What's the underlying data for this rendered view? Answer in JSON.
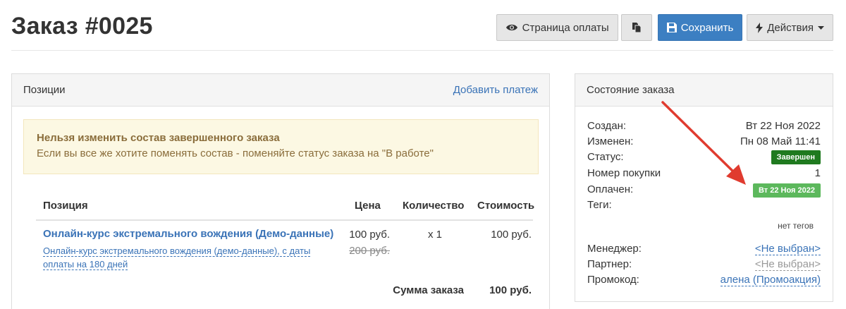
{
  "page": {
    "title": "Заказ #0025"
  },
  "toolbar": {
    "payment_page_label": "Страница оплаты",
    "copy_icon": "copy-icon",
    "save_label": "Сохранить",
    "actions_label": "Действия"
  },
  "positions": {
    "title": "Позиции",
    "add_payment_label": "Добавить платеж",
    "alert": {
      "title": "Нельзя изменить состав завершенного заказа",
      "text": "Если вы все же хотите поменять состав - поменяйте статус заказа на \"В работе\""
    },
    "columns": {
      "item": "Позиция",
      "price": "Цена",
      "qty": "Количество",
      "cost": "Стоимость"
    },
    "items": [
      {
        "title": "Онлайн-курс экстремального вождения (Демо-данные)",
        "description": "Онлайн-курс экстремального вождения (демо-данные), с даты оплаты на 180 дней",
        "price": "100 руб.",
        "price_old": "200 руб.",
        "qty": "x 1",
        "cost": "100 руб."
      }
    ],
    "total_label": "Сумма заказа",
    "total_value": "100 руб."
  },
  "state": {
    "title": "Состояние заказа",
    "created_label": "Создан:",
    "created_value": "Вт 22 Ноя 2022",
    "modified_label": "Изменен:",
    "modified_value": "Пн 08 Май 11:41",
    "status_label": "Статус:",
    "status_value": "Завершен",
    "purchase_label": "Номер покупки",
    "purchase_value": "1",
    "paid_label": "Оплачен:",
    "paid_value": "Вт 22 Ноя 2022",
    "tags_label": "Теги:",
    "no_tags": "нет тегов",
    "manager_label": "Менеджер:",
    "manager_value": "<Не выбран>",
    "partner_label": "Партнер:",
    "partner_value": "<Не выбран>",
    "promo_label": "Промокод:",
    "promo_value": "алена (Промоакция)"
  },
  "colors": {
    "primary": "#3c7fc2",
    "link": "#3a73b7",
    "status_completed": "#1f7a1f",
    "status_paid": "#5cb85c",
    "alert_bg": "#fcf8e3",
    "annotation_arrow": "#e03b2f"
  }
}
